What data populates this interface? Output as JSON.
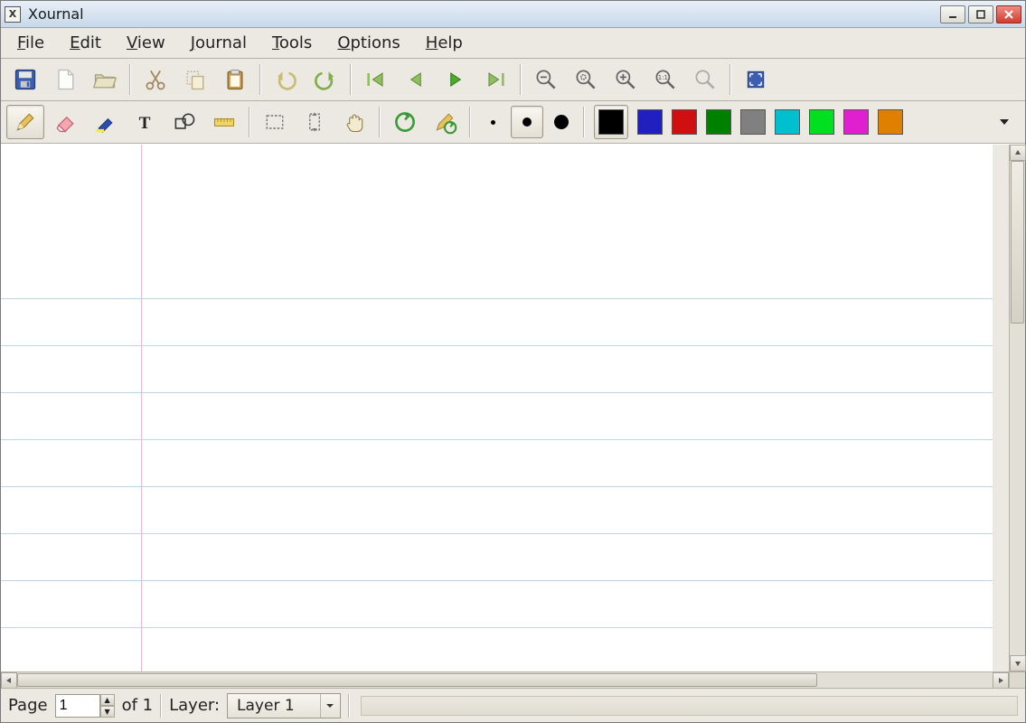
{
  "window": {
    "title": "Xournal",
    "appicon_letter": "X"
  },
  "menu": {
    "file": "File",
    "edit": "Edit",
    "view": "View",
    "journal": "Journal",
    "tools": "Tools",
    "options": "Options",
    "help": "Help"
  },
  "colors": {
    "black": "#000000",
    "blue": "#2020c0",
    "red": "#d01010",
    "green": "#008000",
    "gray": "#808080",
    "cyan": "#00c0d0",
    "lime": "#00e020",
    "magenta": "#e020d0",
    "orange": "#e08000"
  },
  "status": {
    "page_label": "Page",
    "page_current": "1",
    "page_of": "of 1",
    "layer_label": "Layer:",
    "layer_value": "Layer 1"
  }
}
